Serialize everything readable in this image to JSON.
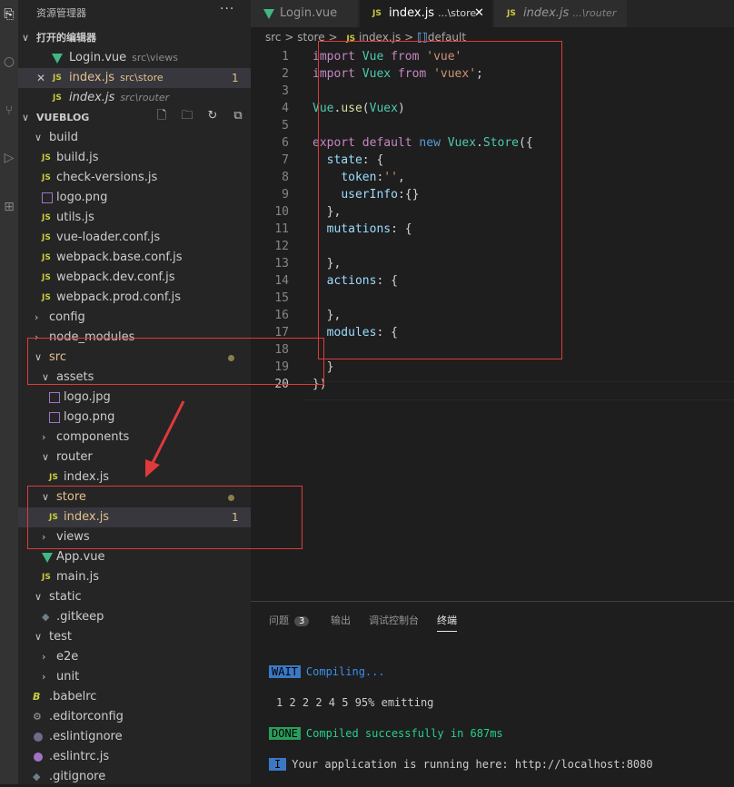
{
  "explorer": {
    "title": "资源管理器",
    "more": "···",
    "open_editors": {
      "title": "打开的编辑器",
      "items": [
        {
          "name": "Login.vue",
          "path": "src\\views"
        },
        {
          "name": "index.js",
          "path": "src\\store",
          "badge": "1"
        },
        {
          "name": "index.js",
          "path": "src\\router"
        }
      ]
    },
    "project": {
      "title": "VUEBLOG",
      "tree": {
        "build": "build",
        "build_js": "build.js",
        "check_versions": "check-versions.js",
        "logo_png_build": "logo.png",
        "utils_js": "utils.js",
        "vue_loader": "vue-loader.conf.js",
        "webpack_base": "webpack.base.conf.js",
        "webpack_dev": "webpack.dev.conf.js",
        "webpack_prod": "webpack.prod.conf.js",
        "config": "config",
        "node_modules": "node_modules",
        "src": "src",
        "assets": "assets",
        "logo_jpg": "logo.jpg",
        "logo_png": "logo.png",
        "components": "components",
        "router": "router",
        "router_index": "index.js",
        "store": "store",
        "store_index": "index.js",
        "store_index_badge": "1",
        "views": "views",
        "app_vue": "App.vue",
        "main_js": "main.js",
        "static": "static",
        "gitkeep": ".gitkeep",
        "test": "test",
        "e2e": "e2e",
        "unit": "unit",
        "babelrc": ".babelrc",
        "editorconfig": ".editorconfig",
        "eslintignore": ".eslintignore",
        "eslintrc": ".eslintrc.js",
        "gitignore": ".gitignore"
      }
    }
  },
  "tabs": [
    {
      "label": "Login.vue",
      "sub": ""
    },
    {
      "label": "index.js",
      "sub": "...\\store",
      "close": "✕"
    },
    {
      "label": "index.js",
      "sub": "...\\router"
    }
  ],
  "breadcrumb": {
    "src": "src",
    "store": "store",
    "file": "index.js",
    "symbol": "default",
    "sep": ">"
  },
  "code_lines": [
    "import Vue from 'vue'",
    "import Vuex from 'vuex';",
    "",
    "Vue.use(Vuex)",
    "",
    "export default new Vuex.Store({",
    "  state: {",
    "    token:'',",
    "    userInfo:{}",
    "  },",
    "  mutations: {",
    "",
    "  },",
    "  actions: {",
    "",
    "  },",
    "  modules: {",
    "",
    "  }",
    "})"
  ],
  "panel": {
    "tabs": {
      "problems": "问题",
      "problems_count": "3",
      "output": "输出",
      "debug": "调试控制台",
      "terminal": "终端"
    },
    "terminal": {
      "wait_tag": "WAIT",
      "wait_msg": "Compiling...",
      "progress": "1 2 2 2 4 5 95% emitting",
      "done_tag": "DONE",
      "done_msg": "Compiled successfully in 687ms",
      "info_tag": "I",
      "info_msg": "Your application is running here: http://localhost:8080"
    }
  },
  "colors": {
    "accent_red": "#e03a3a",
    "js_yellow": "#cbcb41",
    "vue_green": "#41b883",
    "wait_blue": "#3b78c4",
    "done_green": "#2a9d5c"
  }
}
